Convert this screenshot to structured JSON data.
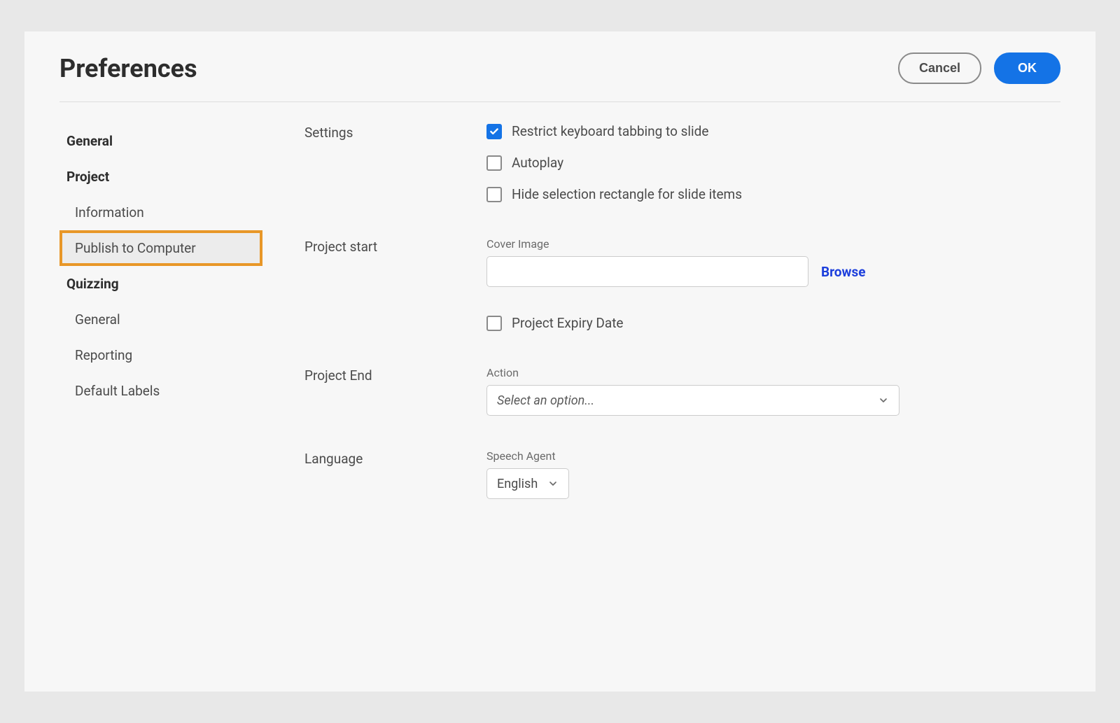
{
  "header": {
    "title": "Preferences",
    "cancel_label": "Cancel",
    "ok_label": "OK"
  },
  "sidebar": {
    "items": [
      {
        "label": "General",
        "type": "category"
      },
      {
        "label": "Project",
        "type": "category"
      },
      {
        "label": "Information",
        "type": "sub"
      },
      {
        "label": "Publish to Computer",
        "type": "sub",
        "selected": true
      },
      {
        "label": "Quizzing",
        "type": "category"
      },
      {
        "label": "General",
        "type": "sub"
      },
      {
        "label": "Reporting",
        "type": "sub"
      },
      {
        "label": "Default Labels",
        "type": "sub"
      }
    ]
  },
  "sections": {
    "settings": {
      "label": "Settings",
      "restrict_tabbing": {
        "label": "Restrict keyboard tabbing to slide",
        "checked": true
      },
      "autoplay": {
        "label": "Autoplay",
        "checked": false
      },
      "hide_selection": {
        "label": "Hide selection rectangle for slide items",
        "checked": false
      }
    },
    "project_start": {
      "label": "Project start",
      "cover_image_label": "Cover Image",
      "cover_image_value": "",
      "browse_label": "Browse",
      "expiry_date": {
        "label": "Project Expiry Date",
        "checked": false
      }
    },
    "project_end": {
      "label": "Project End",
      "action_label": "Action",
      "action_placeholder": "Select an option..."
    },
    "language": {
      "label": "Language",
      "speech_agent_label": "Speech Agent",
      "speech_agent_value": "English"
    }
  }
}
